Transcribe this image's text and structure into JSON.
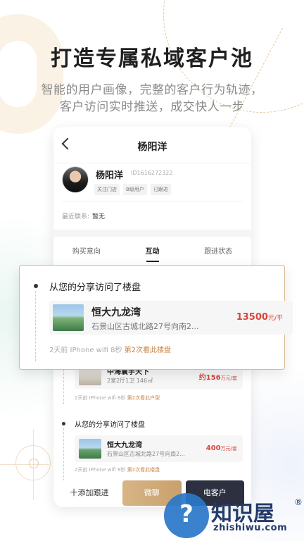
{
  "headline": "打造专属私域客户池",
  "subtitle": {
    "line1": "智能的用户画像，完整的客户行为轨迹，",
    "line2": "客户访问实时推送，成交快人一步"
  },
  "phone": {
    "nav_title": "杨阳洋",
    "profile": {
      "name": "杨阳洋",
      "id": "ID1616272322",
      "tags": [
        "关注门店",
        "B级用户",
        "已跟进"
      ]
    },
    "last_contact_label": "最近联系:",
    "last_contact_value": "暂无",
    "tabs": [
      "购买意向",
      "互动",
      "跟进状态"
    ],
    "items": [
      {
        "prop_name": "中海寰宇天下",
        "prop_addr": "2室2厅1卫 146㎡",
        "price_value": "约156",
        "price_unit": "万元/套",
        "meta_text": "2天前 IPhone wifi 8秒 ",
        "meta_highlight": "第2次看此户型"
      },
      {
        "title": "从您的分享访问了楼盘",
        "prop_name": "恒大九龙湾",
        "prop_addr": "石景山区古城北路27号向南2...",
        "price_value": "400",
        "price_unit": "万元/套",
        "meta_text": "2天前 IPhone wifi 8秒 ",
        "meta_highlight": "第2次看此楼盘"
      }
    ],
    "bottom": {
      "add_label": "十添加跟进",
      "wechat_label": "微聊",
      "call_label": "电客户"
    }
  },
  "popup": {
    "title": "从您的分享访问了楼盘",
    "prop_name": "恒大九龙湾",
    "prop_addr": "石景山区古城北路27号向南2...",
    "price_value": "13500",
    "price_unit": "元/平",
    "meta_text": "2天前 IPhone wifi 8秒 ",
    "meta_highlight": "第2次看此楼盘"
  },
  "watermark": {
    "icon": "question-mark-monitor-icon",
    "text": "知识屋",
    "reg": "®",
    "url": "zhishiwu.com"
  }
}
